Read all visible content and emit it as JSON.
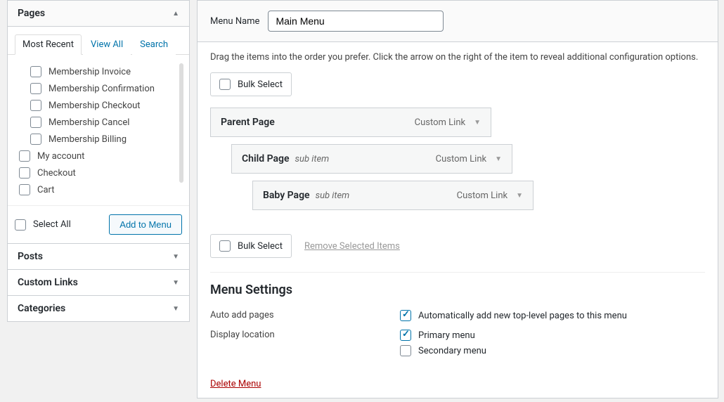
{
  "sidebar": {
    "panels": [
      {
        "title": "Pages",
        "expanded": true
      },
      {
        "title": "Posts",
        "expanded": false
      },
      {
        "title": "Custom Links",
        "expanded": false
      },
      {
        "title": "Categories",
        "expanded": false
      }
    ],
    "tabs": [
      "Most Recent",
      "View All",
      "Search"
    ],
    "pages_indented": [
      "Membership Invoice",
      "Membership Confirmation",
      "Membership Checkout",
      "Membership Cancel",
      "Membership Billing"
    ],
    "pages_top": [
      "My account",
      "Checkout",
      "Cart"
    ],
    "select_all": "Select All",
    "add_button": "Add to Menu"
  },
  "main": {
    "menu_name_label": "Menu Name",
    "menu_name_value": "Main Menu",
    "instructions": "Drag the items into the order you prefer. Click the arrow on the right of the item to reveal additional configuration options.",
    "bulk_select": "Bulk Select",
    "remove_selected": "Remove Selected Items",
    "menu_items": [
      {
        "title": "Parent Page",
        "suffix": "",
        "type": "Custom Link",
        "indent": 0
      },
      {
        "title": "Child Page",
        "suffix": "sub item",
        "type": "Custom Link",
        "indent": 1
      },
      {
        "title": "Baby Page",
        "suffix": "sub item",
        "type": "Custom Link",
        "indent": 2
      }
    ],
    "settings_heading": "Menu Settings",
    "auto_add_label": "Auto add pages",
    "auto_add_text": "Automatically add new top-level pages to this menu",
    "display_label": "Display location",
    "locations": [
      {
        "label": "Primary menu",
        "checked": true
      },
      {
        "label": "Secondary menu",
        "checked": false
      }
    ],
    "delete": "Delete Menu"
  }
}
